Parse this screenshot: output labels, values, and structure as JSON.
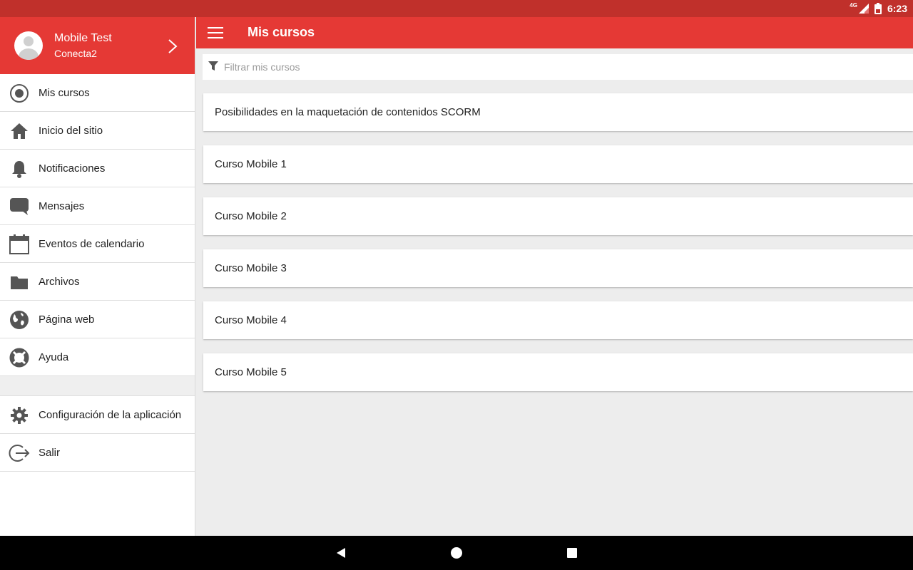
{
  "status_bar": {
    "network": "4G",
    "time": "6:23"
  },
  "sidebar": {
    "profile": {
      "name": "Mobile Test",
      "site": "Conecta2"
    },
    "items": [
      {
        "label": "Mis cursos",
        "icon": "target-icon"
      },
      {
        "label": "Inicio del sitio",
        "icon": "home-icon"
      },
      {
        "label": "Notificaciones",
        "icon": "bell-icon"
      },
      {
        "label": "Mensajes",
        "icon": "chat-bubble-icon"
      },
      {
        "label": "Eventos de calendario",
        "icon": "calendar-icon"
      },
      {
        "label": "Archivos",
        "icon": "folder-icon"
      },
      {
        "label": "Página web",
        "icon": "globe-icon"
      },
      {
        "label": "Ayuda",
        "icon": "lifebuoy-icon"
      }
    ],
    "bottom_items": [
      {
        "label": "Configuración de la aplicación",
        "icon": "gear-icon"
      },
      {
        "label": "Salir",
        "icon": "logout-icon"
      }
    ]
  },
  "toolbar": {
    "title": "Mis cursos"
  },
  "filter": {
    "placeholder": "Filtrar mis cursos",
    "value": ""
  },
  "courses": [
    "Posibilidades en la maquetación de contenidos SCORM",
    "Curso Mobile 1",
    "Curso Mobile 2",
    "Curso Mobile 3",
    "Curso Mobile 4",
    "Curso Mobile 5"
  ],
  "colors": {
    "accent": "#e53935",
    "status_bar": "#c0302b",
    "background": "#ededed"
  }
}
